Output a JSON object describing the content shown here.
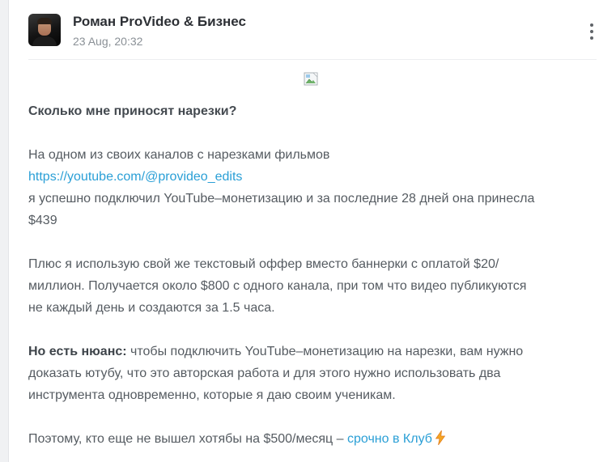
{
  "post": {
    "author": "Роман ProVideo & Бизнес",
    "date": "23 Aug, 20:32"
  },
  "content": {
    "title": "Сколько мне приносят нарезки?",
    "p1_line1": "На одном из своих каналов с нарезками фильмов",
    "p1_link": "https://youtube.com/@provideo_edits",
    "p1_line3": "я успешно подключил YouTube–монетизацию и за последние 28 дней она принесла",
    "p1_line4": "$439",
    "p2_line1": "Плюс я использую свой же текстовый оффер вместо баннерки с оплатой $20/",
    "p2_line2": "миллион. Получается около $800 с одного канала, при том что видео публикуются",
    "p2_line3": "не каждый день и создаются за 1.5 часа.",
    "p3_bold": "Но есть нюанс:",
    "p3_line1_rest": " чтобы подключить YouTube–монетизацию на нарезки, вам нужно",
    "p3_line2": "доказать ютубу, что это авторская работа и для этого нужно использовать два",
    "p3_line3": "инструмента одновременно, которые я даю своим ученикам.",
    "p4_text": "Поэтому, кто еще не вышел хотябы на $500/месяц – ",
    "p4_link": "срочно в Клуб",
    "p4_emoji": "lightning-emoji"
  },
  "colors": {
    "link": "#2a9fd6",
    "text": "#555b61",
    "author": "#2d3035",
    "date": "#8a9096",
    "background": "#f0f1f3"
  },
  "icons": {
    "menu": "more-vertical-icon",
    "image": "broken-image-icon",
    "avatar": "author-avatar"
  }
}
